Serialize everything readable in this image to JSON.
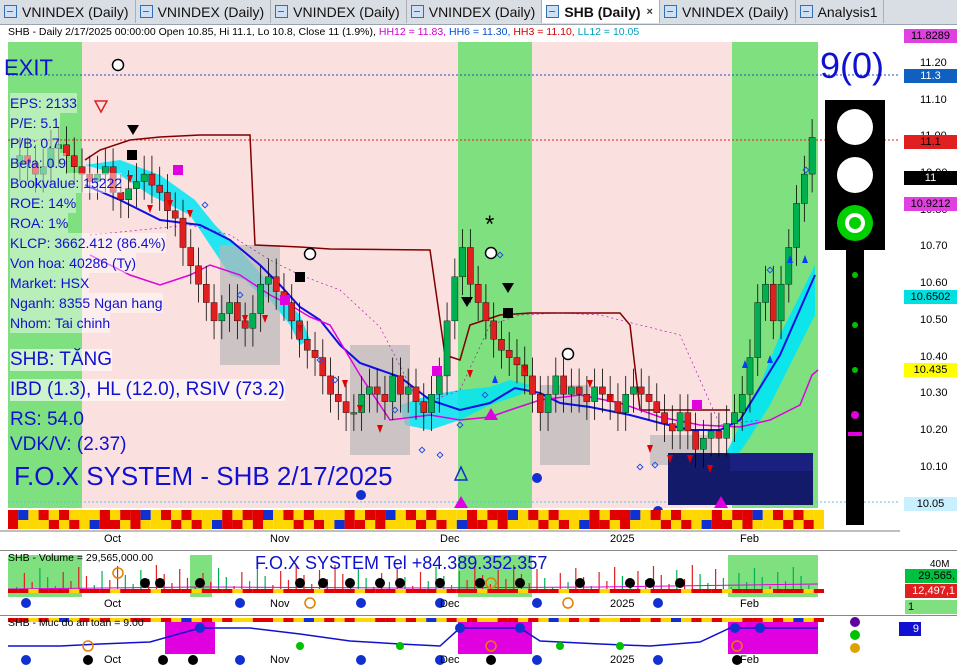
{
  "tabs": [
    {
      "label": "VNINDEX (Daily)",
      "active": false
    },
    {
      "label": "VNINDEX (Daily)",
      "active": false
    },
    {
      "label": "VNINDEX (Daily)",
      "active": false
    },
    {
      "label": "VNINDEX (Daily)",
      "active": false
    },
    {
      "label": "SHB (Daily)",
      "active": true,
      "close": "×"
    },
    {
      "label": "VNINDEX (Daily)",
      "active": false
    },
    {
      "label": "Analysis1",
      "active": false
    }
  ],
  "main": {
    "header_prefix": "SHB - Daily 2/17/2025 00:00:00 Open 10.85, Hi 11.1, Lo 10.8, Close 11 (1.9%)",
    "hh12": "HH12 = 11.83,",
    "hh6": "HH6 = 11.30,",
    "hh3": "HH3 = 11.10,",
    "ll12": "LL12 = 10.05",
    "exit_label": "EXIT",
    "signal_count": "9(0)",
    "fundamentals": [
      "EPS: 2133",
      "P/E: 5.1",
      "P/B: 0.7",
      "Beta: 0.9",
      "Bookvalue: 15222",
      "ROE: 14%",
      "ROA: 1%",
      "KLCP: 3662.412 (86.4%)",
      "Von hoa: 40286 (Ty)",
      "Market: HSX",
      "Nganh: 8355 Ngan hang",
      "Nhom: Tai chinh"
    ],
    "trend": "SHB: TĂNG",
    "indicators": "IBD (1.3), HL (12.0), RSIV (73.2)",
    "rs": "RS: 54.0",
    "vdk": "VDK/V:  (2.37)",
    "system_title": "F.O.X SYSTEM - SHB 2/17/2025",
    "star": "*",
    "price_scale": [
      "11.20",
      "11.10",
      "11.00",
      "10.90",
      "10.80",
      "10.70",
      "10.60",
      "10.50",
      "10.40",
      "10.30",
      "10.20",
      "10.10",
      "10.00"
    ],
    "price_tags": [
      {
        "label": "11.8289",
        "color": "#e040e0",
        "text": "#000"
      },
      {
        "label": "11.3",
        "color": "#1060c0",
        "text": "#fff"
      },
      {
        "label": "11.1",
        "color": "#e02020",
        "text": "#000"
      },
      {
        "label": "11",
        "color": "#000000",
        "text": "#fff"
      },
      {
        "label": "10.9212",
        "color": "#e040e0",
        "text": "#000"
      },
      {
        "label": "10.6502",
        "color": "#00e0e0",
        "text": "#000"
      },
      {
        "label": "10.435",
        "color": "#ffff00",
        "text": "#000"
      },
      {
        "label": "10.05",
        "color": "#c8f0ff",
        "text": "#000"
      }
    ],
    "months": [
      "Oct",
      "Nov",
      "Dec",
      "2025",
      "Feb"
    ]
  },
  "volume": {
    "header": "SHB - Volume = 29,565,000.00",
    "contact": "F.O.X SYSTEM Tel +84.389.352.357",
    "scale_top": "40M",
    "value_tag": "29,565,",
    "value_tag2": "12,497,1",
    "small_tag": "1",
    "months": [
      "Oct",
      "Nov",
      "Dec",
      "2025",
      "Feb"
    ]
  },
  "muc": {
    "header": "SHB - Muc do an toan = 9.00",
    "value_tag": "9",
    "months": [
      "Oct",
      "Nov",
      "Dec",
      "2025",
      "Feb"
    ]
  },
  "colors": {
    "buy_zone": "#7fe07f",
    "sell_zone": "#fbe0e0",
    "up_candle": "#00b050",
    "down_candle": "#e02020",
    "ma_blue": "#1010e0",
    "ma_dark": "#800000",
    "cloud": "#00e5f5",
    "magenta": "#e000e0"
  }
}
